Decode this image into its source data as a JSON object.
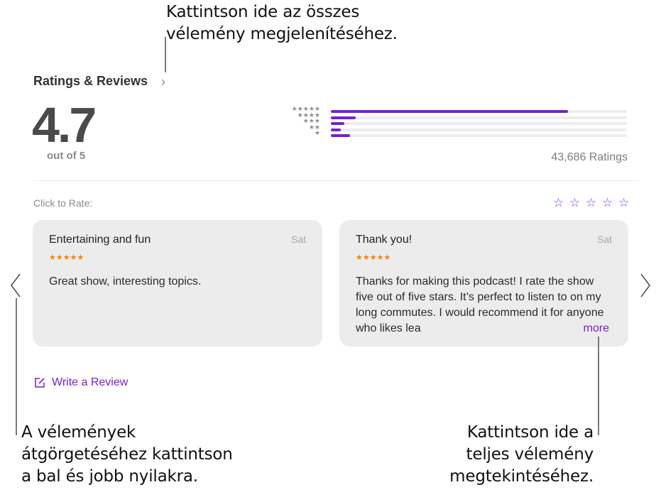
{
  "callouts": {
    "top": [
      "Kattintson ide az összes",
      "vélemény megjelenítéséhez."
    ],
    "bottom_left": [
      "A vélemények",
      "átgörgetéséhez kattintson",
      "a bal és jobb nyilakra."
    ],
    "bottom_right": [
      "Kattintson ide a",
      "teljes vélemény",
      "megtekintéséhez."
    ]
  },
  "ratings": {
    "section_title": "Ratings & Reviews",
    "chevron": "›",
    "average": "4.7",
    "out_of": "out of 5",
    "total_label": "43,686 Ratings",
    "distribution": [
      {
        "stars": 5,
        "label": "★★★★★",
        "fraction": 0.8
      },
      {
        "stars": 4,
        "label": "★★★★",
        "fraction": 0.084
      },
      {
        "stars": 3,
        "label": "★★★",
        "fraction": 0.045
      },
      {
        "stars": 2,
        "label": "★★",
        "fraction": 0.034
      },
      {
        "stars": 1,
        "label": "★",
        "fraction": 0.065
      }
    ],
    "bar_color": "#7a1fd1"
  },
  "rate": {
    "label": "Click to Rate:",
    "stars": [
      "☆",
      "☆",
      "☆",
      "☆",
      "☆"
    ]
  },
  "reviews": [
    {
      "title": "Entertaining and fun",
      "date": "Sat",
      "stars": "★★★★★",
      "body": "Great show, interesting topics."
    },
    {
      "title": "Thank you!",
      "date": "Sat",
      "stars": "★★★★★",
      "body": "Thanks for making this podcast! I rate the show five out of five stars. It’s perfect to listen to on my long commutes. I would recommend it for anyone who likes lea",
      "more_label": "more"
    }
  ],
  "nav": {
    "prev_icon": "chevron-left-icon",
    "next_icon": "chevron-right-icon"
  },
  "write_review": {
    "label": "Write a Review",
    "icon": "compose-icon"
  },
  "colors": {
    "accent": "#7a1fd1",
    "review_stars": "#f5820d",
    "card_bg": "#ececec"
  }
}
